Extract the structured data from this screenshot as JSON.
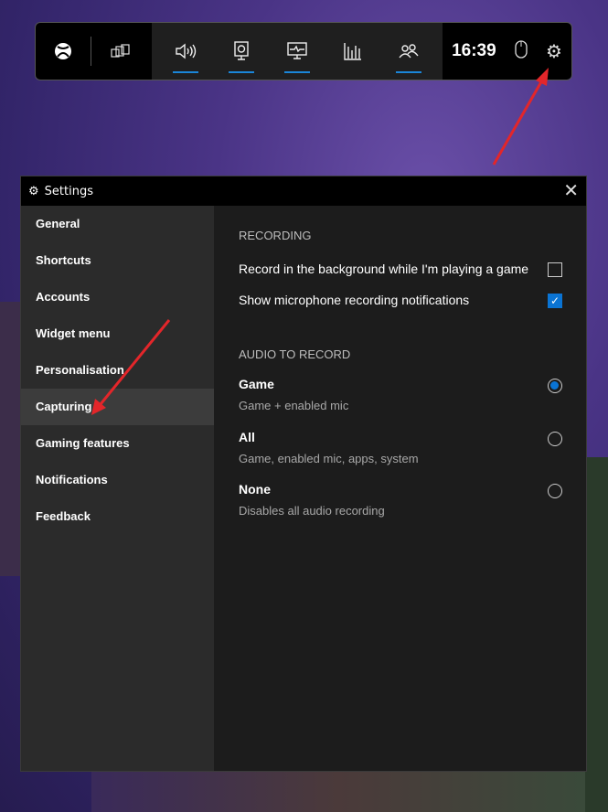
{
  "gamebar": {
    "time": "16:39",
    "widgets": [
      {
        "name": "xbox-icon",
        "active": false
      },
      {
        "name": "widget-store-icon",
        "active": false
      },
      {
        "name": "audio-icon",
        "active": true
      },
      {
        "name": "capture-icon",
        "active": true
      },
      {
        "name": "performance-icon",
        "active": true
      },
      {
        "name": "resources-icon",
        "active": false
      },
      {
        "name": "xbox-social-icon",
        "active": true
      }
    ]
  },
  "settings": {
    "title": "Settings",
    "sidebar": [
      "General",
      "Shortcuts",
      "Accounts",
      "Widget menu",
      "Personalisation",
      "Capturing",
      "Gaming features",
      "Notifications",
      "Feedback"
    ],
    "selected": "Capturing",
    "recording": {
      "heading": "RECORDING",
      "options": [
        {
          "label": "Record in the background while I'm playing a game",
          "checked": false
        },
        {
          "label": "Show microphone recording notifications",
          "checked": true
        }
      ]
    },
    "audio": {
      "heading": "AUDIO TO RECORD",
      "options": [
        {
          "title": "Game",
          "desc": "Game + enabled mic",
          "selected": true
        },
        {
          "title": "All",
          "desc": "Game, enabled mic, apps, system",
          "selected": false
        },
        {
          "title": "None",
          "desc": "Disables all audio recording",
          "selected": false
        }
      ]
    }
  },
  "colors": {
    "accent": "#0a74d4",
    "arrow": "#e3262a"
  }
}
